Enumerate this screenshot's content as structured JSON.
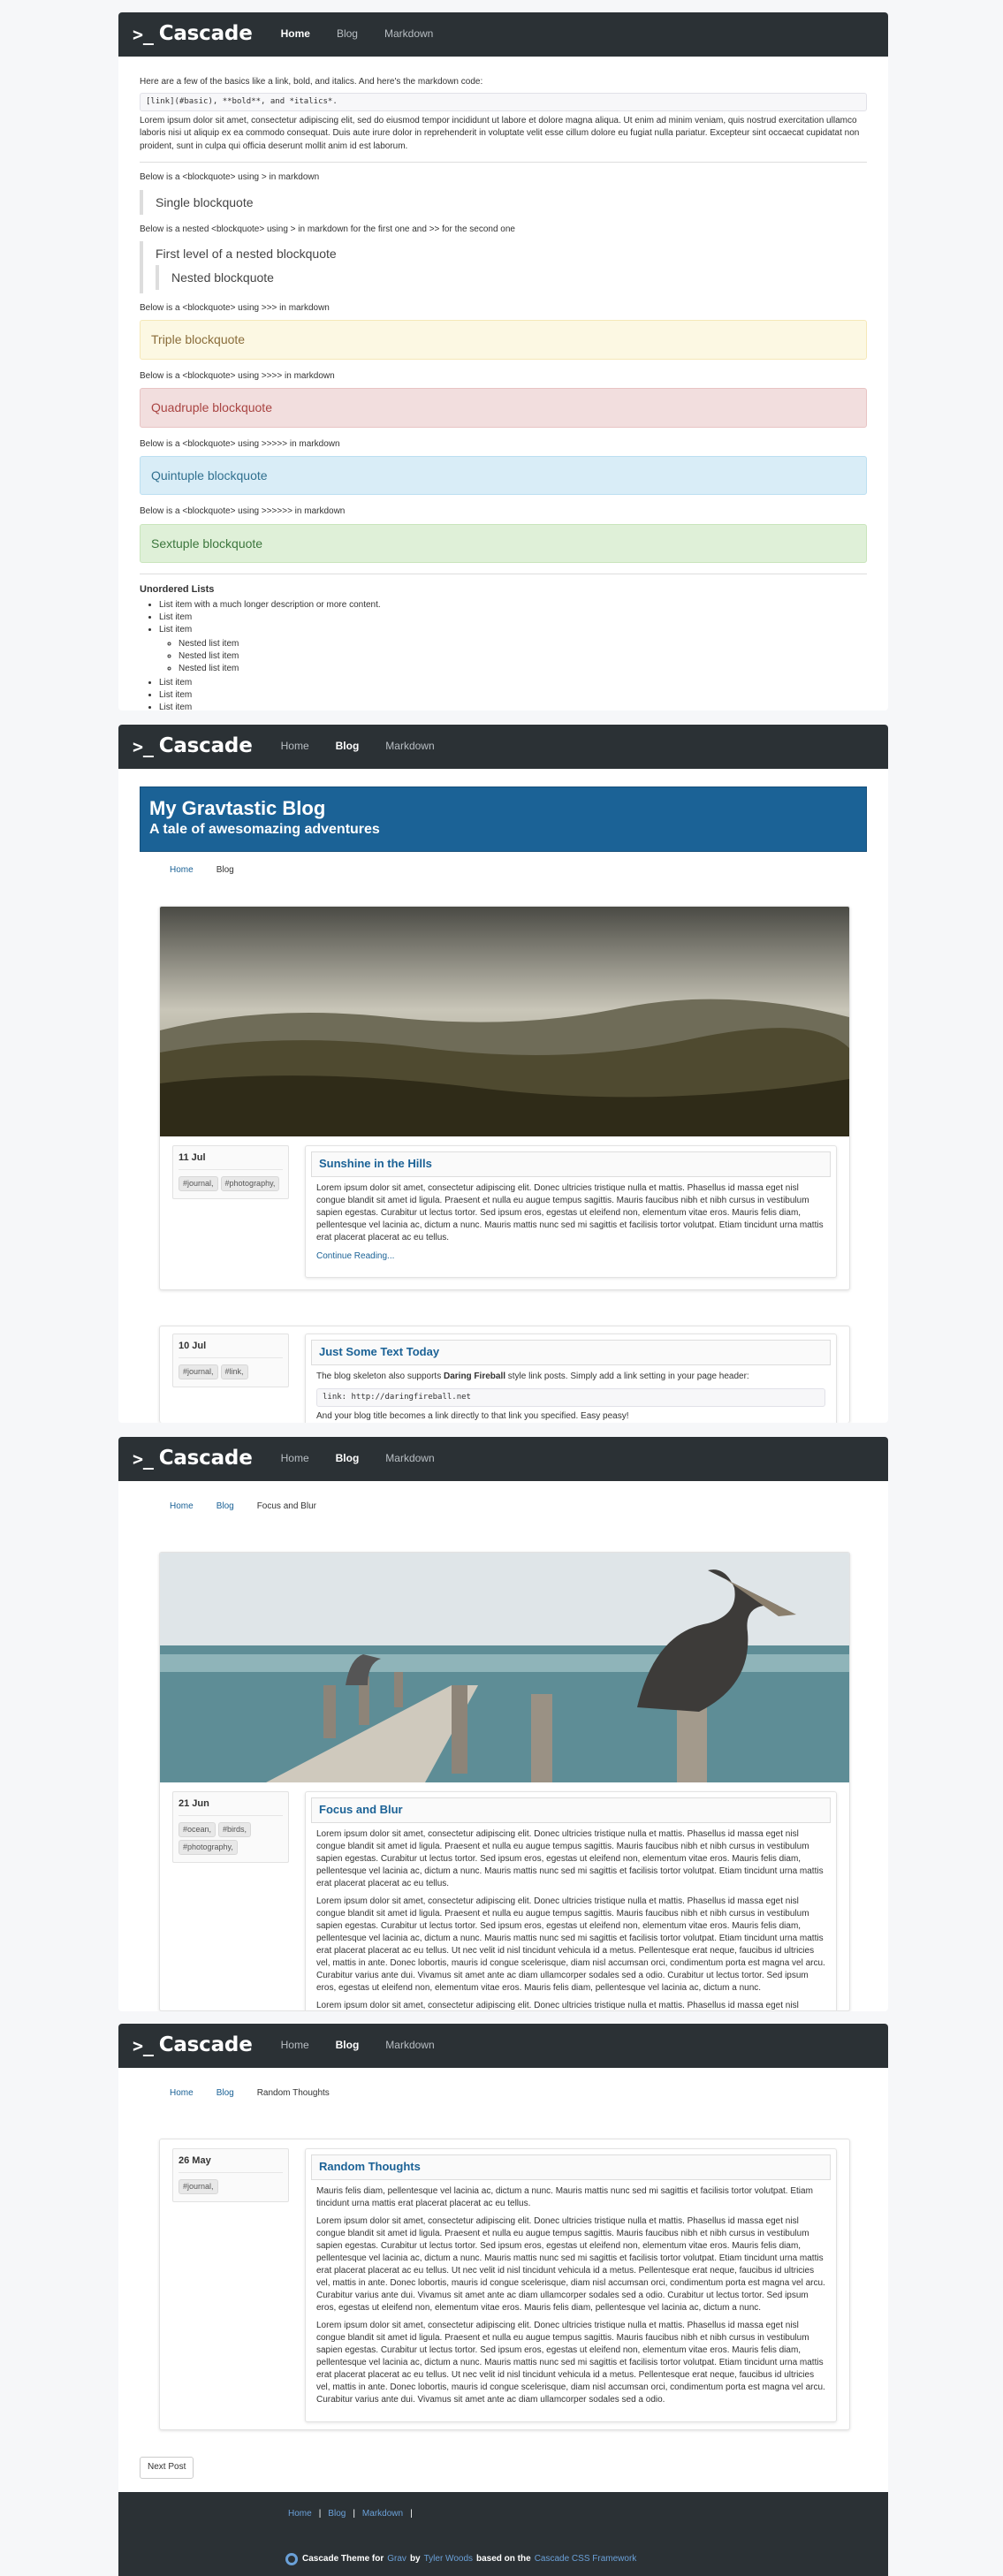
{
  "brand": "Cascade",
  "nav": [
    "Home",
    "Blog",
    "Markdown"
  ],
  "markdown": {
    "intro": "Here are a few of the basics like a link, bold, and italics. And here's the markdown code:",
    "code": "[link](#basic), **bold**, and *italics*.",
    "lorem": "Lorem ipsum dolor sit amet, consectetur adipiscing elit, sed do eiusmod tempor incididunt ut labore et dolore magna aliqua. Ut enim ad minim veniam, quis nostrud exercitation ullamco laboris nisi ut aliquip ex ea commodo consequat. Duis aute irure dolor in reprehenderit in voluptate velit esse cillum dolore eu fugiat nulla pariatur. Excepteur sint occaecat cupidatat non proident, sunt in culpa qui officia deserunt mollit anim id est laborum.",
    "single_note": "Below is a <blockquote> using > in markdown",
    "single": "Single blockquote",
    "nested_note": "Below is a nested <blockquote> using > in markdown for the first one and >> for the second one",
    "nested1": "First level of a nested blockquote",
    "nested2": "Nested blockquote",
    "triple_note": "Below is a <blockquote> using >>> in markdown",
    "triple": "Triple blockquote",
    "quad_note": "Below is a <blockquote> using >>>> in markdown",
    "quad": "Quadruple blockquote",
    "quint_note": "Below is a <blockquote> using >>>>> in markdown",
    "quint": "Quintuple blockquote",
    "sext_note": "Below is a <blockquote> using >>>>>> in markdown",
    "sext": "Sextuple blockquote",
    "list_title": "Unordered Lists",
    "list": [
      "List item with a much longer description or more content.",
      "List item",
      "List item"
    ],
    "nested_list": [
      "Nested list item",
      "Nested list item",
      "Nested list item"
    ],
    "list_after": [
      "List item",
      "List item",
      "List item"
    ]
  },
  "blog": {
    "title": "My Gravtastic Blog",
    "subtitle": "A tale of awesomazing adventures",
    "crumbs": [
      "Home",
      "Blog"
    ],
    "post1": {
      "date": "11 Jul",
      "tags": [
        "#journal,",
        "#photography,"
      ],
      "title": "Sunshine in the Hills",
      "body": "Lorem ipsum dolor sit amet, consectetur adipiscing elit. Donec ultricies tristique nulla et mattis. Phasellus id massa eget nisl congue blandit sit amet id ligula. Praesent et nulla eu augue tempus sagittis. Mauris faucibus nibh et nibh cursus in vestibulum sapien egestas. Curabitur ut lectus tortor. Sed ipsum eros, egestas ut eleifend non, elementum vitae eros. Mauris felis diam, pellentesque vel lacinia ac, dictum a nunc. Mauris mattis nunc sed mi sagittis et facilisis tortor volutpat. Etiam tincidunt urna mattis erat placerat placerat ac eu tellus.",
      "more": "Continue Reading..."
    },
    "post2": {
      "date": "10 Jul",
      "tags": [
        "#journal,",
        "#link,"
      ],
      "title": "Just Some Text Today",
      "body_pre": "The blog skeleton also supports ",
      "body_bold": "Daring Fireball",
      "body_post": " style link posts. Simply add a link setting in your page header:",
      "code": "link: http://daringfireball.net",
      "after": "And your blog title becomes a link directly to that link you specified. Easy peasy!"
    }
  },
  "focus": {
    "crumbs": [
      "Home",
      "Blog",
      "Focus and Blur"
    ],
    "date": "21 Jun",
    "tags": [
      "#ocean,",
      "#birds,",
      "#photography,"
    ],
    "title": "Focus and Blur",
    "p1": "Lorem ipsum dolor sit amet, consectetur adipiscing elit. Donec ultricies tristique nulla et mattis. Phasellus id massa eget nisl congue blandit sit amet id ligula. Praesent et nulla eu augue tempus sagittis. Mauris faucibus nibh et nibh cursus in vestibulum sapien egestas. Curabitur ut lectus tortor. Sed ipsum eros, egestas ut eleifend non, elementum vitae eros. Mauris felis diam, pellentesque vel lacinia ac, dictum a nunc. Mauris mattis nunc sed mi sagittis et facilisis tortor volutpat. Etiam tincidunt urna mattis erat placerat placerat ac eu tellus.",
    "p2": "Lorem ipsum dolor sit amet, consectetur adipiscing elit. Donec ultricies tristique nulla et mattis. Phasellus id massa eget nisl congue blandit sit amet id ligula. Praesent et nulla eu augue tempus sagittis. Mauris faucibus nibh et nibh cursus in vestibulum sapien egestas. Curabitur ut lectus tortor. Sed ipsum eros, egestas ut eleifend non, elementum vitae eros. Mauris felis diam, pellentesque vel lacinia ac, dictum a nunc. Mauris mattis nunc sed mi sagittis et facilisis tortor volutpat. Etiam tincidunt urna mattis erat placerat placerat ac eu tellus. Ut nec velit id nisl tincidunt vehicula id a metus. Pellentesque erat neque, faucibus id ultricies vel, mattis in ante. Donec lobortis, mauris id congue scelerisque, diam nisl accumsan orci, condimentum porta est magna vel arcu. Curabitur varius ante dui. Vivamus sit amet ante ac diam ullamcorper sodales sed a odio. Curabitur ut lectus tortor. Sed ipsum eros, egestas ut eleifend non, elementum vitae eros. Mauris felis diam, pellentesque vel lacinia ac, dictum a nunc.",
    "p3": "Lorem ipsum dolor sit amet, consectetur adipiscing elit. Donec ultricies tristique nulla et mattis. Phasellus id massa eget nisl congue"
  },
  "random": {
    "crumbs": [
      "Home",
      "Blog",
      "Random Thoughts"
    ],
    "date": "26 May",
    "tags": [
      "#journal,"
    ],
    "title": "Random Thoughts",
    "p1": "Mauris felis diam, pellentesque vel lacinia ac, dictum a nunc. Mauris mattis nunc sed mi sagittis et facilisis tortor volutpat. Etiam tincidunt urna mattis erat placerat placerat ac eu tellus.",
    "p2": "Lorem ipsum dolor sit amet, consectetur adipiscing elit. Donec ultricies tristique nulla et mattis. Phasellus id massa eget nisl congue blandit sit amet id ligula. Praesent et nulla eu augue tempus sagittis. Mauris faucibus nibh et nibh cursus in vestibulum sapien egestas. Curabitur ut lectus tortor. Sed ipsum eros, egestas ut eleifend non, elementum vitae eros. Mauris felis diam, pellentesque vel lacinia ac, dictum a nunc. Mauris mattis nunc sed mi sagittis et facilisis tortor volutpat. Etiam tincidunt urna mattis erat placerat placerat ac eu tellus. Ut nec velit id nisl tincidunt vehicula id a metus. Pellentesque erat neque, faucibus id ultricies vel, mattis in ante. Donec lobortis, mauris id congue scelerisque, diam nisl accumsan orci, condimentum porta est magna vel arcu. Curabitur varius ante dui. Vivamus sit amet ante ac diam ullamcorper sodales sed a odio. Curabitur ut lectus tortor. Sed ipsum eros, egestas ut eleifend non, elementum vitae eros. Mauris felis diam, pellentesque vel lacinia ac, dictum a nunc.",
    "p3": "Lorem ipsum dolor sit amet, consectetur adipiscing elit. Donec ultricies tristique nulla et mattis. Phasellus id massa eget nisl congue blandit sit amet id ligula. Praesent et nulla eu augue tempus sagittis. Mauris faucibus nibh et nibh cursus in vestibulum sapien egestas. Curabitur ut lectus tortor. Sed ipsum eros, egestas ut eleifend non, elementum vitae eros. Mauris felis diam, pellentesque vel lacinia ac, dictum a nunc. Mauris mattis nunc sed mi sagittis et facilisis tortor volutpat. Etiam tincidunt urna mattis erat placerat placerat ac eu tellus. Ut nec velit id nisl tincidunt vehicula id a metus. Pellentesque erat neque, faucibus id ultricies vel, mattis in ante. Donec lobortis, mauris id congue scelerisque, diam nisl accumsan orci, condimentum porta est magna vel arcu. Curabitur varius ante dui. Vivamus sit amet ante ac diam ullamcorper sodales sed a odio.",
    "next": "Next Post"
  },
  "footer": {
    "links": [
      "Home",
      "Blog",
      "Markdown"
    ],
    "c1": "Cascade Theme for ",
    "grav": "Grav",
    "by": " by ",
    "author": "Tyler Woods",
    "based": " based on the ",
    "css": "Cascade CSS Framework"
  }
}
